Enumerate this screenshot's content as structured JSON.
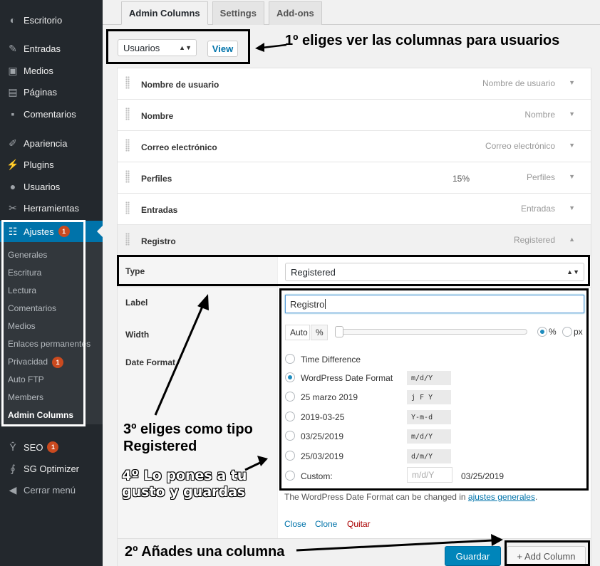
{
  "sidebar": {
    "items": [
      {
        "label": "Escritorio",
        "icon": "dashboard-icon"
      },
      {
        "label": "Entradas",
        "icon": "pin-icon"
      },
      {
        "label": "Medios",
        "icon": "media-icon"
      },
      {
        "label": "Páginas",
        "icon": "page-icon"
      },
      {
        "label": "Comentarios",
        "icon": "comment-icon"
      },
      {
        "label": "Apariencia",
        "icon": "brush-icon"
      },
      {
        "label": "Plugins",
        "icon": "plugin-icon"
      },
      {
        "label": "Usuarios",
        "icon": "user-icon"
      },
      {
        "label": "Herramientas",
        "icon": "wrench-icon"
      },
      {
        "label": "Ajustes",
        "icon": "settings-icon",
        "badge": "1"
      },
      {
        "label": "SEO",
        "icon": "seo-icon",
        "badge": "1"
      },
      {
        "label": "SG Optimizer",
        "icon": "sg-icon"
      },
      {
        "label": "Cerrar menú",
        "icon": "collapse-icon"
      }
    ],
    "submenu": [
      "Generales",
      "Escritura",
      "Lectura",
      "Comentarios",
      "Medios",
      "Enlaces permanentes",
      "Privacidad",
      "Auto FTP",
      "Members",
      "Admin Columns"
    ],
    "submenu_badge": "1"
  },
  "tabs": [
    "Admin Columns",
    "Settings",
    "Add-ons"
  ],
  "list_screen": {
    "selected": "Usuarios",
    "view_label": "View"
  },
  "columns": [
    {
      "label": "Nombre de usuario",
      "type": "Nombre de usuario",
      "width": ""
    },
    {
      "label": "Nombre",
      "type": "Nombre",
      "width": ""
    },
    {
      "label": "Correo electrónico",
      "type": "Correo electrónico",
      "width": ""
    },
    {
      "label": "Perfiles",
      "type": "Perfiles",
      "width": "15%"
    },
    {
      "label": "Entradas",
      "type": "Entradas",
      "width": ""
    },
    {
      "label": "Registro",
      "type": "Registered",
      "width": ""
    }
  ],
  "settings": {
    "type_label": "Type",
    "type_value": "Registered",
    "label_label": "Label",
    "label_value": "Registro",
    "width_label": "Width",
    "width_auto": "Auto",
    "width_pct": "%",
    "unit_pct": "%",
    "unit_px": "px",
    "date_format_label": "Date Format",
    "formats": [
      {
        "label": "Time Difference",
        "code": ""
      },
      {
        "label": "WordPress Date Format",
        "code": "m/d/Y"
      },
      {
        "label": "25 marzo 2019",
        "code": "j F Y"
      },
      {
        "label": "2019-03-25",
        "code": "Y-m-d"
      },
      {
        "label": "03/25/2019",
        "code": "m/d/Y"
      },
      {
        "label": "25/03/2019",
        "code": "d/m/Y"
      }
    ],
    "custom_label": "Custom:",
    "custom_placeholder": "m/d/Y",
    "custom_preview": "03/25/2019",
    "note_text": "The WordPress Date Format can be changed in ",
    "note_link": "ajustes generales",
    "note_end": ".",
    "actions": {
      "close": "Close",
      "clone": "Clone",
      "remove": "Quitar"
    }
  },
  "footer": {
    "save": "Guardar",
    "add_column": "+ Add Column"
  },
  "annotations": {
    "step1": "1º eliges ver las columnas para usuarios",
    "step2": "2º Añades una columna",
    "step3_a": "3º eliges como tipo",
    "step3_b": "Registered",
    "step4_a": "4º Lo pones a tu",
    "step4_b": "gusto y guardas"
  }
}
